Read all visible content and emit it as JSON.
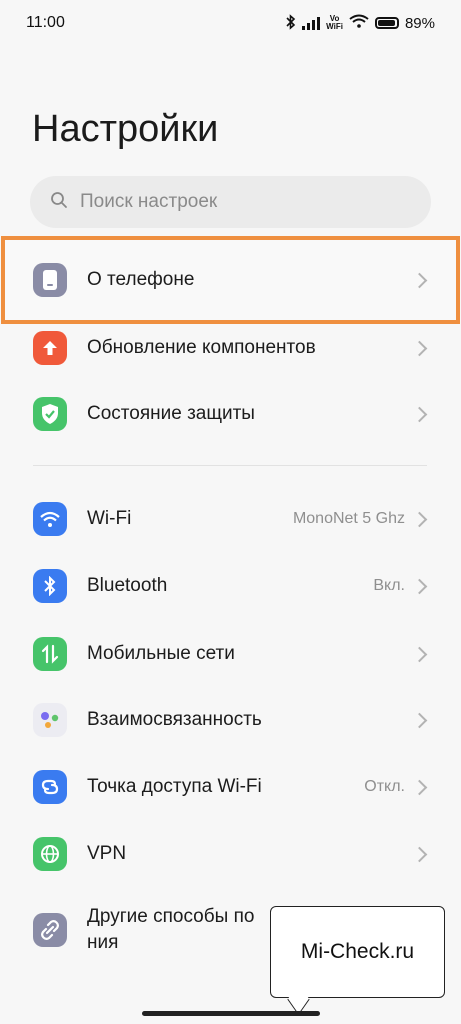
{
  "status": {
    "time": "11:00",
    "vowifi": "Vo\nWiFi",
    "battery": "89%"
  },
  "page_title": "Настройки",
  "search": {
    "placeholder": "Поиск настроек"
  },
  "items": [
    {
      "label": "О телефоне",
      "value": ""
    },
    {
      "label": "Обновление компонентов",
      "value": ""
    },
    {
      "label": "Состояние защиты",
      "value": ""
    },
    {
      "label": "Wi-Fi",
      "value": "MonoNet 5 Ghz"
    },
    {
      "label": "Bluetooth",
      "value": "Вкл."
    },
    {
      "label": "Мобильные сети",
      "value": ""
    },
    {
      "label": "Взаимосвязанность",
      "value": ""
    },
    {
      "label": "Точка доступа Wi-Fi",
      "value": "Откл."
    },
    {
      "label": "VPN",
      "value": ""
    },
    {
      "label": "Другие способы по\nния",
      "value": ""
    }
  ],
  "watermark": "Mi-Check.ru",
  "colors": {
    "highlight": "#ef8f3f",
    "phone_icon": "#8a8ca6",
    "update_icon": "#f0593a",
    "security_icon": "#46c46a",
    "wifi_icon": "#3a7bf0",
    "bluetooth_icon": "#3a7bf0",
    "mobile_icon": "#46c46a",
    "hotspot_icon": "#3a7bf0",
    "vpn_icon": "#46c46a",
    "other_icon": "#8a8ca6"
  }
}
